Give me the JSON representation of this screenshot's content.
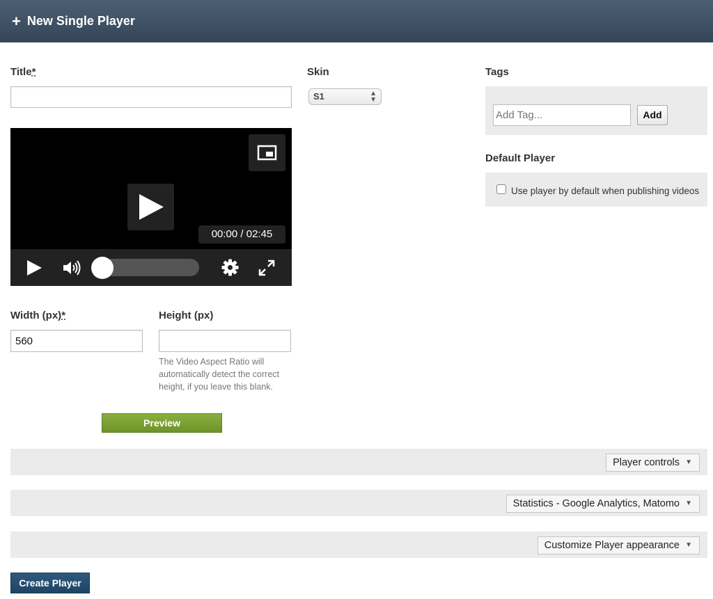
{
  "header": {
    "title": "New Single Player",
    "icon": "plus-icon"
  },
  "form": {
    "title_label": "Title",
    "required_mark": "*",
    "title_value": "",
    "skin_label": "Skin",
    "skin_value": "S1",
    "tags_label": "Tags",
    "tag_placeholder": "Add Tag...",
    "add_label": "Add",
    "default_label": "Default Player",
    "default_checkbox_label": "Use player by default when publishing videos",
    "default_checked": false,
    "width_label": "Width (px)",
    "width_value": "560",
    "height_label": "Height (px)",
    "height_value": "",
    "height_help": "The Video Aspect Ratio will automatically detect the correct height, if you leave this blank.",
    "preview_label": "Preview"
  },
  "player": {
    "time": "00:00 / 02:45",
    "progress": 0,
    "icons": [
      "picture-in-picture-icon",
      "play-icon",
      "volume-icon",
      "gear-icon",
      "fullscreen-icon"
    ]
  },
  "sections": [
    {
      "label": "Player controls"
    },
    {
      "label": "Statistics - Google Analytics, Matomo"
    },
    {
      "label": "Customize Player appearance"
    }
  ],
  "footer": {
    "create_label": "Create Player"
  },
  "colors": {
    "header": "#3d4f63",
    "preview": "#7aa035",
    "create": "#254d6f"
  }
}
